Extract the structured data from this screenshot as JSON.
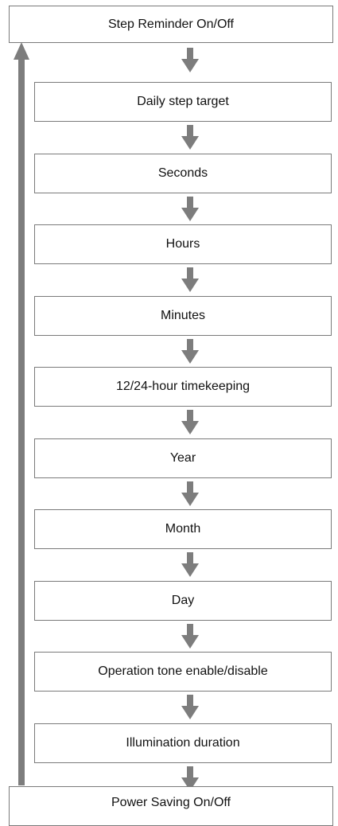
{
  "diagram": {
    "top_label": "Step Reminder On/Off",
    "steps": [
      "Daily step target",
      "Seconds",
      "Hours",
      "Minutes",
      "12/24-hour timekeeping",
      "Year",
      "Month",
      "Day",
      "Operation tone enable/disable",
      "Illumination duration"
    ],
    "bottom_label": "Power Saving On/Off",
    "colors": {
      "arrow": "#7d7d7d",
      "border": "#7a7a7a",
      "text": "#111111"
    }
  }
}
